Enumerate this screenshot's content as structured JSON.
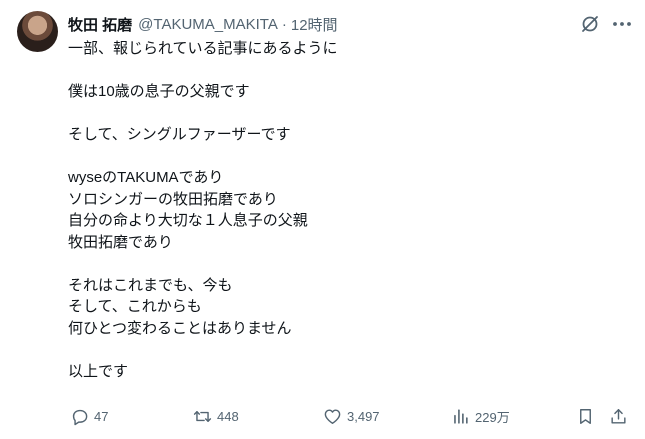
{
  "tweet": {
    "author_name": "牧田 拓磨",
    "handle": "@TAKUMA_MAKITA",
    "separator": "·",
    "time": "12時間",
    "text_lines": [
      "一部、報じられている記事にあるように",
      "",
      "僕は10歳の息子の父親です",
      "",
      "そして、シングルファーザーです",
      "",
      "wyseのTAKUMAであり",
      "ソロシンガーの牧田拓磨であり",
      "自分の命より大切な１人息子の父親",
      "牧田拓磨であり",
      "",
      "それはこれまでも、今も",
      "そして、これからも",
      "何ひとつ変わることはありません",
      "",
      "以上です"
    ]
  },
  "actions": {
    "reply_count": "47",
    "retweet_count": "448",
    "like_count": "3,497",
    "views_count": "229万"
  },
  "icons": {
    "reply": "reply-icon",
    "retweet": "retweet-icon",
    "like": "heart-icon",
    "views": "views-icon",
    "bookmark": "bookmark-icon",
    "share": "share-icon",
    "grok": "grok-icon",
    "more": "more-icon"
  },
  "colors": {
    "text_primary": "#0f1419",
    "text_secondary": "#536471",
    "background": "#ffffff"
  }
}
